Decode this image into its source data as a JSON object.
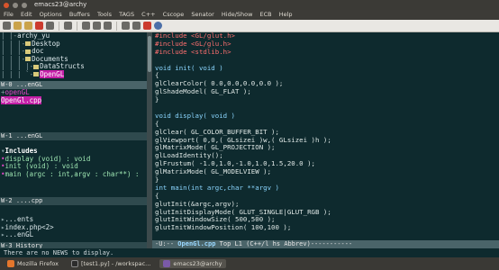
{
  "window": {
    "title": "emacs23@archy"
  },
  "menu": [
    "File",
    "Edit",
    "Options",
    "Buffers",
    "Tools",
    "TAGS",
    "C++",
    "Cscope",
    "Senator",
    "Hide/Show",
    "ECB",
    "Help"
  ],
  "toolbar_icons": [
    "new-file-icon",
    "open-folder-icon",
    "open-dir-icon",
    "close-icon",
    "save-icon",
    "cut-icon",
    "copy-icon",
    "paste-icon",
    "undo-icon",
    "search-icon",
    "print-icon",
    "cancel-icon",
    "info-icon"
  ],
  "directories": {
    "lines": [
      "archy_yu",
      "Desktop",
      "doc",
      "Documents",
      "DataStructs",
      "OpenGL"
    ],
    "modeline": "W-0  ...enGL"
  },
  "sources": {
    "lines": [
      "openGL",
      "OpenGl.cpp"
    ],
    "modeline": "W-1  ...enGL"
  },
  "methods": {
    "header": "Includes",
    "lines": [
      "display (void) : void",
      "init (void) : void",
      "main (argc : int,argv : char**) :"
    ],
    "modeline": "W-2  ....cpp"
  },
  "history": {
    "lines": [
      "...ents",
      "index.php<2>",
      "...enGL"
    ],
    "modeline": "W-3  History"
  },
  "code": {
    "lines": [
      "#include <GL/glut.h>",
      "#include <GL/glu.h>",
      "#include <stdlib.h>",
      "",
      "void init( void )",
      "{",
      "    glClearColor( 0.0,0.0,0.0,0.0 );",
      "    glShadeModel( GL_FLAT );",
      "}",
      "",
      "void display( void )",
      "{",
      "    glClear( GL_COLOR_BUFFER_BIT );",
      "    glViewport( 0,0,( GLsizei )w,( GLsizei )h );",
      "    glMatrixMode( GL_PROJECTION );",
      "    glLoadIdentity();",
      "    glFrustum( -1.0,1.0,-1.0,1.0,1.5,20.0 );",
      "    glMatrixMode( GL_MODELVIEW );",
      "}",
      "int main(int argc,char **argv )",
      "{",
      "    glutInit(&argc,argv);",
      "    glutInitDisplayMode( GLUT_SINGLE|GLUT_RGB );",
      "    glutInitWindowSize( 500,500 );",
      "    glutInitWindowPosition( 100,100 );"
    ],
    "modeline": {
      "prefix": "-U:--",
      "buffer": "OpenGl.cpp",
      "rest": "Top L1     (C++/l hs Abbrev)-----------"
    }
  },
  "echo": "There are no NEWS to display.",
  "taskbar": [
    {
      "label": "Mozilla Firefox",
      "icon": "firefox-icon"
    },
    {
      "label": "[test1.py] - /workspac...",
      "icon": "terminal-icon"
    },
    {
      "label": "emacs23@archy",
      "icon": "emacs-icon"
    }
  ],
  "colors": {
    "background": "#0e2a2e",
    "selection": "#c41fa7",
    "modeline": "#4a6469"
  }
}
